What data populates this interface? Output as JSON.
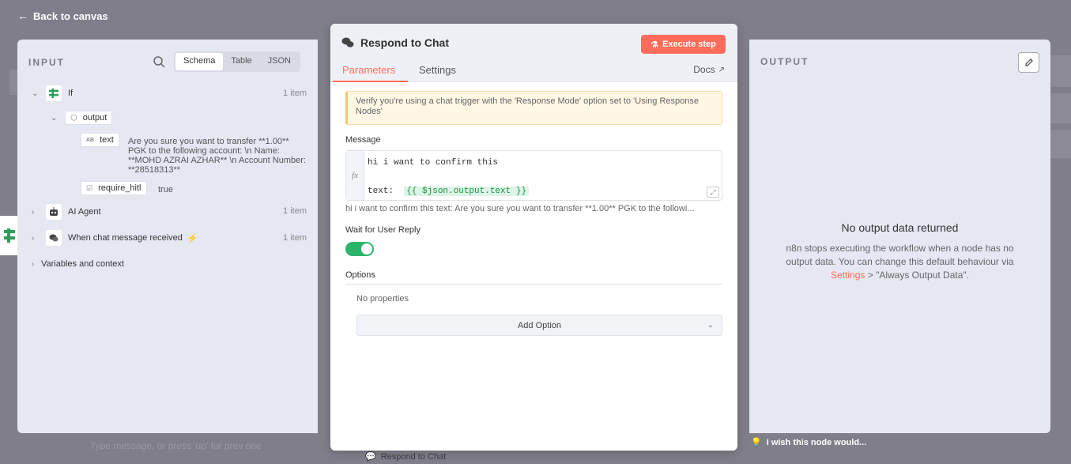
{
  "back_link": "Back to canvas",
  "input_panel": {
    "title": "INPUT",
    "tabs": [
      "Schema",
      "Table",
      "JSON"
    ],
    "tree": {
      "if_label": "If",
      "if_count": "1 item",
      "output_label": "output",
      "text_type": "AB",
      "text_key": "text",
      "text_value": "Are you sure you want to transfer **1.00** PGK to the following account: \\n Name: **MOHD AZRAI AZHAR** \\n Account Number: **28518313**",
      "require_key": "require_hitl",
      "require_value": "true",
      "ai_agent_label": "AI Agent",
      "ai_agent_count": "1 item",
      "chat_label": "When chat message received",
      "chat_count": "1 item",
      "variables_label": "Variables and context"
    }
  },
  "center_panel": {
    "title": "Respond to Chat",
    "execute_label": "Execute step",
    "tab_parameters": "Parameters",
    "tab_settings": "Settings",
    "docs_label": "Docs",
    "notice": "Verify you're using a chat trigger with the 'Response Mode' option set to 'Using Response Nodes'",
    "message_label": "Message",
    "fx_label": "fx",
    "message_line1": "hi i want to confirm this",
    "message_line2_prefix": "text:  ",
    "message_expr": "{{ $json.output.text }}",
    "preview": "hi i want to confirm this text:  Are you sure you want to transfer **1.00** PGK to the followi...",
    "wait_label": "Wait for User Reply",
    "wait_enabled": true,
    "options_label": "Options",
    "no_properties": "No properties",
    "add_option": "Add Option"
  },
  "output_panel": {
    "title": "OUTPUT",
    "no_output_title": "No output data returned",
    "desc_part1": "n8n stops executing the workflow when a node has no output data. You can change this default behaviour via ",
    "desc_link": "Settings",
    "desc_part2": " > \"Always Output Data\"."
  },
  "background": {
    "chat_placeholder": "Type message, or press 'up' for prev one",
    "respond_node_label": "Respond to Chat",
    "wish_label": "I wish this node would..."
  },
  "colors": {
    "accent": "#ff6d5a",
    "toggle_on": "#2db46c",
    "panel_bg": "#e5e8f1"
  }
}
